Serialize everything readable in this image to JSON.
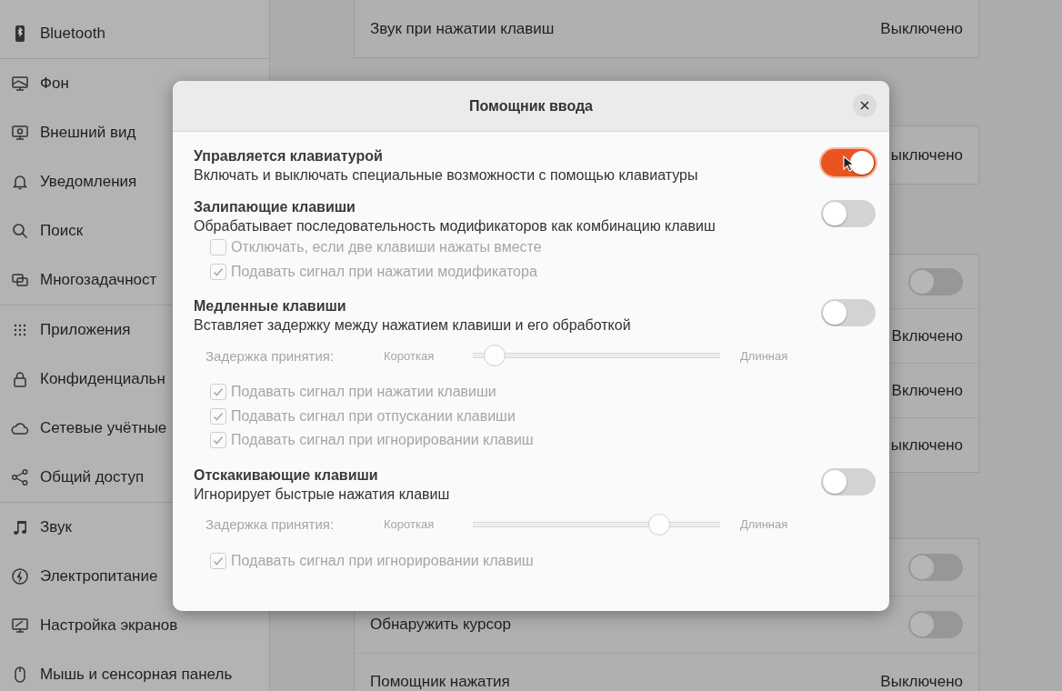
{
  "sidebar": {
    "sections": [
      {
        "items": [
          {
            "label": "Bluetooth"
          }
        ]
      },
      {
        "items": [
          {
            "label": "Фон"
          },
          {
            "label": "Внешний вид"
          },
          {
            "label": "Уведомления"
          },
          {
            "label": "Поиск"
          },
          {
            "label": "Многозадачност"
          }
        ]
      },
      {
        "items": [
          {
            "label": "Приложения"
          },
          {
            "label": "Конфиденциальн"
          },
          {
            "label": "Сетевые учётные"
          },
          {
            "label": "Общий доступ"
          }
        ]
      },
      {
        "items": [
          {
            "label": "Звук"
          },
          {
            "label": "Электропитание"
          },
          {
            "label": "Настройка экранов"
          },
          {
            "label": "Мышь и сенсорная панель"
          }
        ]
      }
    ]
  },
  "panels": [
    {
      "rows": [
        {
          "kind": "value",
          "label": "Звук при нажатии клавиш",
          "value": "Выключено"
        }
      ]
    },
    {
      "rows": [
        {
          "kind": "value",
          "value": "ыключено"
        }
      ]
    },
    {
      "rows": [
        {
          "kind": "toggle",
          "on": false
        },
        {
          "kind": "value",
          "value": "Включено"
        },
        {
          "kind": "value",
          "value": "Включено"
        },
        {
          "kind": "value",
          "value": "ыключено"
        }
      ]
    },
    {
      "rows": [
        {
          "kind": "toggle",
          "on": false
        },
        {
          "kind": "toggle",
          "label": "Обнаружить курсор",
          "on": false
        },
        {
          "kind": "value",
          "label": "Помощник нажатия",
          "value": "Выключено"
        }
      ]
    }
  ],
  "dialog": {
    "title": "Помощник ввода",
    "sections": [
      {
        "title": "Управляется клавиатурой",
        "description": "Включать и выключать специальные возможности с помощью клавиатуры",
        "on": true
      },
      {
        "title": "Залипающие клавиши",
        "description": "Обрабатывает последовательность модификаторов как комбинацию клавиш",
        "on": false,
        "options": [
          {
            "kind": "checkbox",
            "label": "Отключать, если две клавиши нажаты вместе",
            "checked": false
          },
          {
            "kind": "checkbox",
            "label": "Подавать сигнал при нажатии модификатора",
            "checked": true
          }
        ]
      },
      {
        "title": "Медленные клавиши",
        "description": "Вставляет задержку между нажатием клавиши и его обработкой",
        "on": false,
        "options": [
          {
            "kind": "slider",
            "label": "Задержка принятия:",
            "min_label": "Короткая",
            "max_label": "Длинная",
            "level": 0.05
          },
          {
            "kind": "checkbox",
            "label": "Подавать сигнал при нажатии клавиши",
            "checked": true
          },
          {
            "kind": "checkbox",
            "label": "Подавать сигнал при отпускании клавиши",
            "checked": true
          },
          {
            "kind": "checkbox",
            "label": "Подавать сигнал при игнорировании клавиш",
            "checked": true
          }
        ]
      },
      {
        "title": "Отскакивающие клавиши",
        "description": "Игнорирует быстрые нажатия клавиш",
        "on": false,
        "options": [
          {
            "kind": "slider",
            "label": "Задержка принятия:",
            "min_label": "Короткая",
            "max_label": "Длинная",
            "level": 0.78
          },
          {
            "kind": "checkbox",
            "label": "Подавать сигнал при игнорировании клавиш",
            "checked": true
          }
        ]
      }
    ]
  }
}
